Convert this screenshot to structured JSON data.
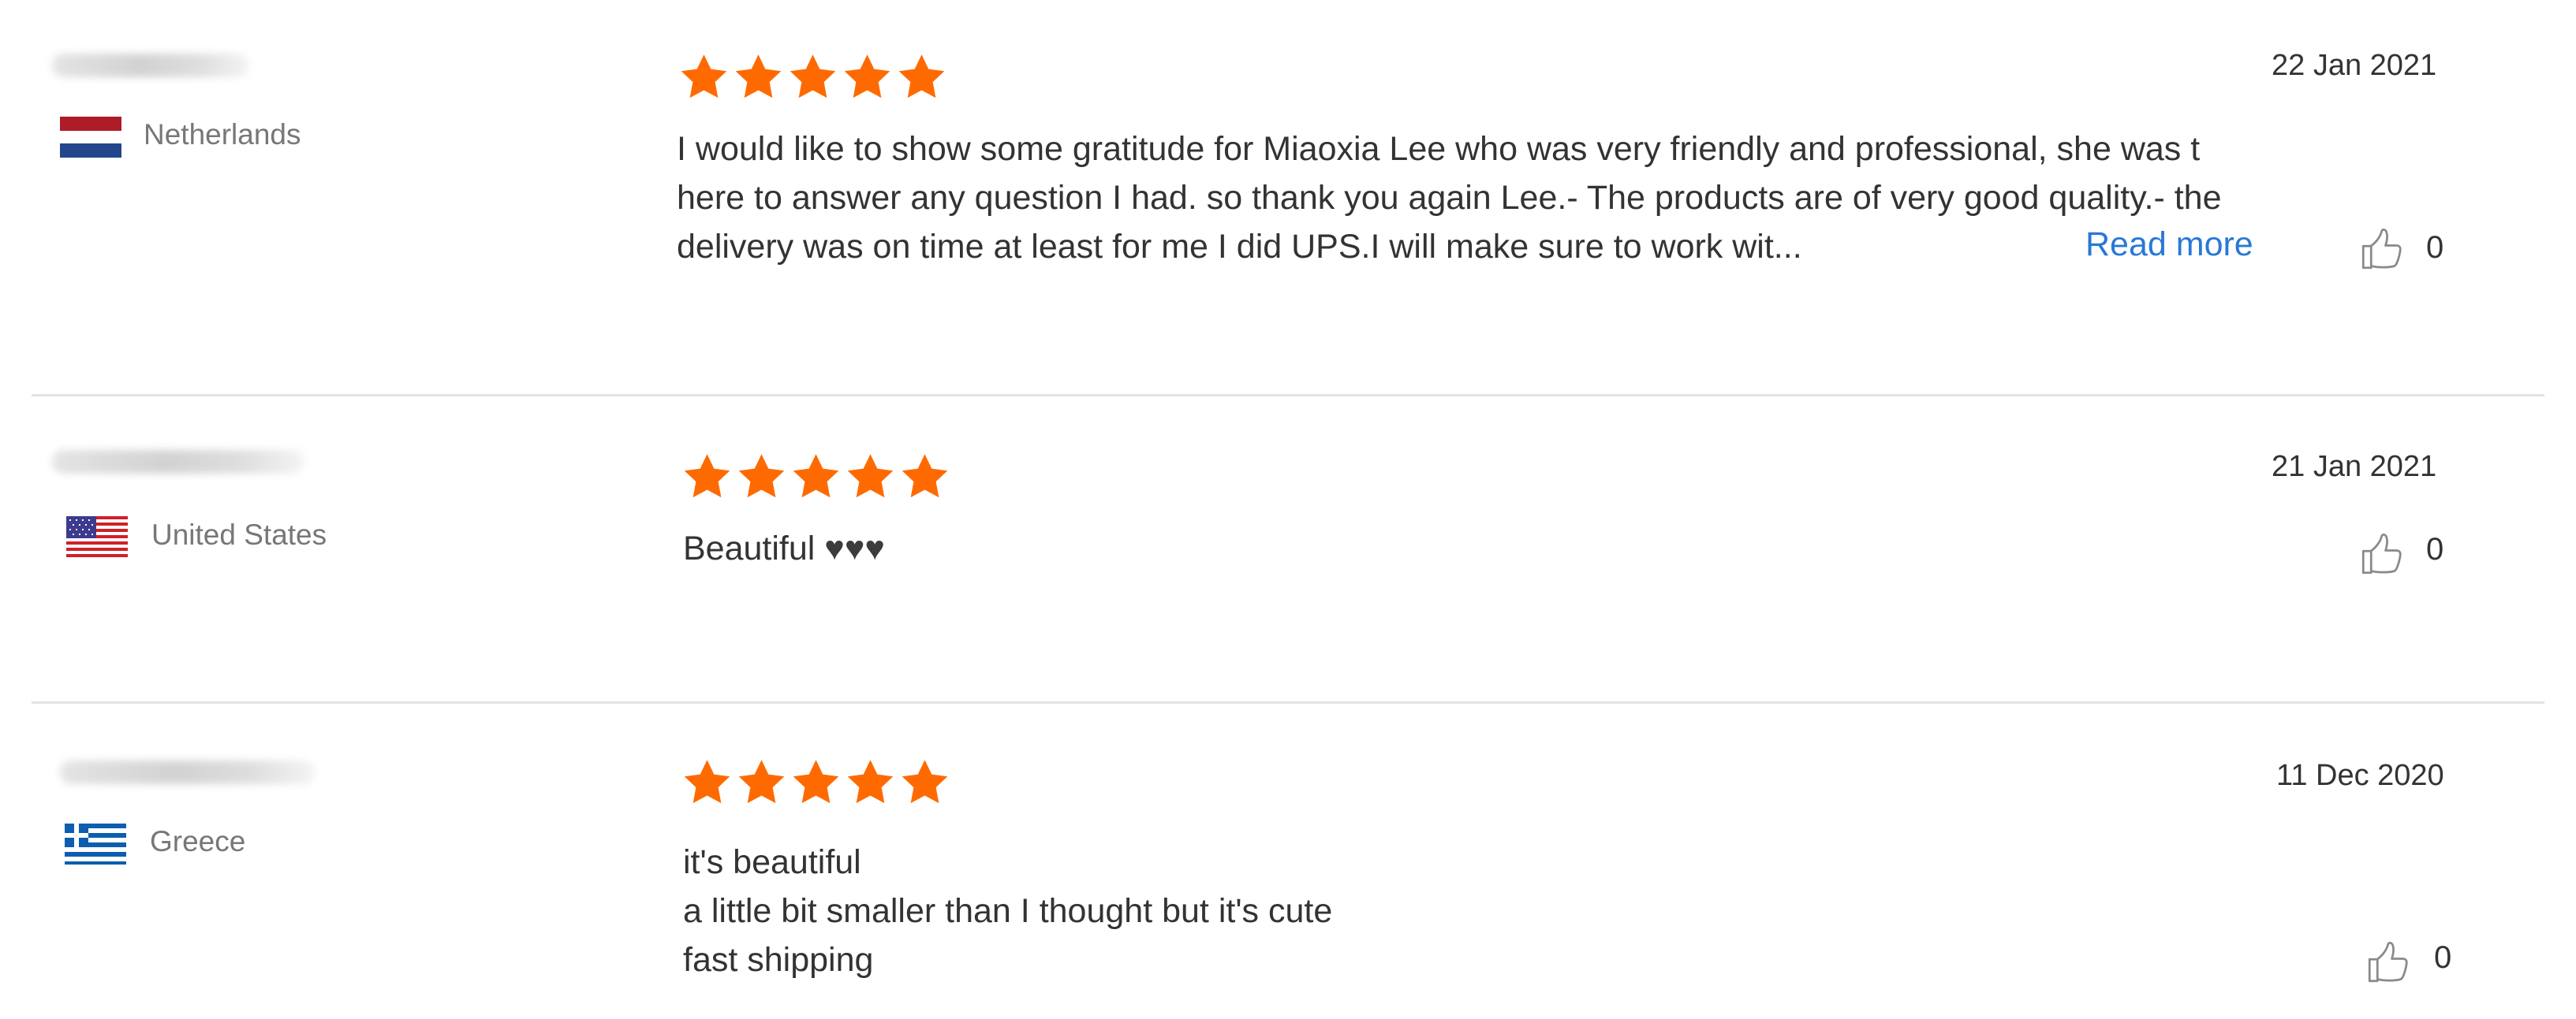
{
  "colors": {
    "star": "#ff6a00",
    "read_more": "#2878d6",
    "divider": "#e3e3e3",
    "text": "#333333",
    "muted": "#777777"
  },
  "read_more_label": "Read more",
  "reviews": [
    {
      "country": "Netherlands",
      "flag": "netherlands-flag-icon",
      "rating": 5,
      "date": "22 Jan 2021",
      "text_lines": [
        "I would like to show some gratitude for Miaoxia Lee who was very friendly and professional, she was t",
        "here to answer any question I had. so thank you again Lee.- The products are of very good quality.- the",
        "delivery was on time at least for me I did UPS.I will make sure to work wit..."
      ],
      "likes": "0"
    },
    {
      "country": "United States",
      "flag": "usa-flag-icon",
      "rating": 5,
      "date": "21 Jan 2021",
      "text_lines": [
        "Beautiful"
      ],
      "hearts": "♥♥♥",
      "likes": "0"
    },
    {
      "country": "Greece",
      "flag": "greece-flag-icon",
      "rating": 5,
      "date": "11 Dec 2020",
      "text_lines": [
        "it's beautiful",
        "a little bit smaller than I thought but it's cute",
        "fast shipping"
      ],
      "likes": "0"
    }
  ]
}
